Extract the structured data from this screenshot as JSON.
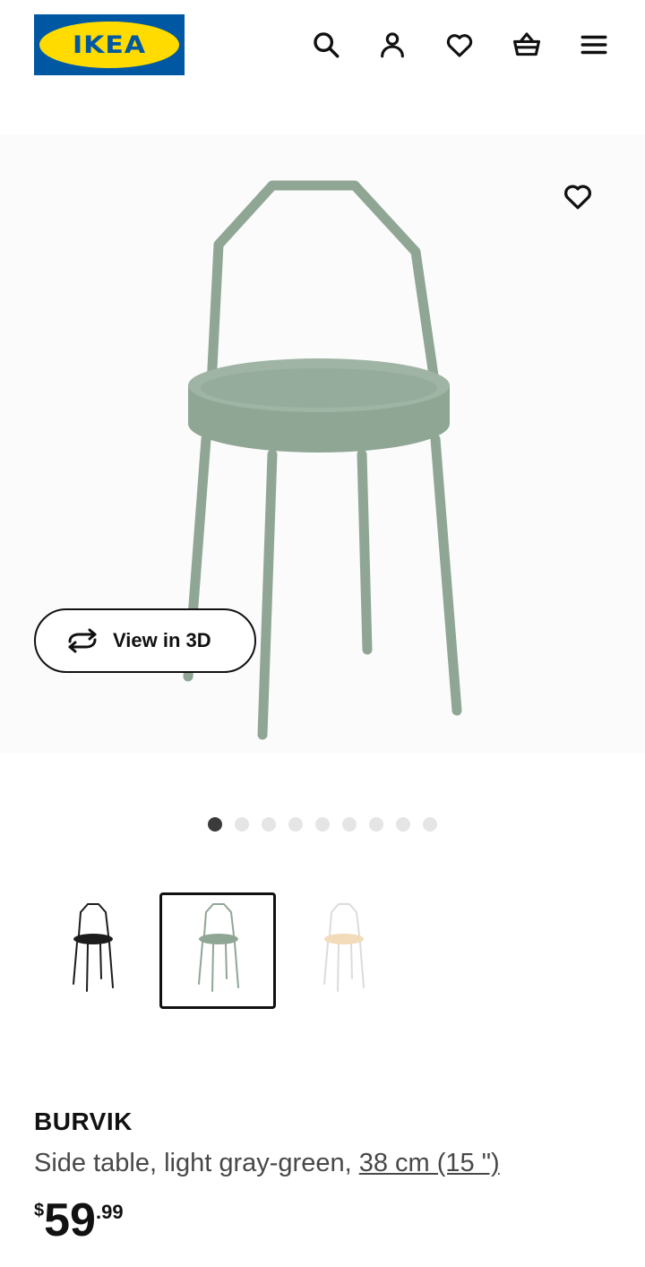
{
  "header": {
    "logo_text": "IKEA",
    "icons": [
      "search-icon",
      "account-icon",
      "wishlist-icon",
      "basket-icon",
      "menu-icon"
    ]
  },
  "gallery": {
    "view_3d_label": "View in 3D",
    "slide_count": 9,
    "active_slide": 1
  },
  "variants": [
    {
      "color_name": "black",
      "color": "#1c1c1c",
      "selected": false
    },
    {
      "color_name": "light gray-green",
      "color": "#8fa695",
      "selected": true
    },
    {
      "color_name": "white/birch",
      "color": "#f2dbb9",
      "selected": false
    }
  ],
  "product": {
    "name": "BURVIK",
    "description": "Side table, light gray-green, ",
    "size": "38 cm (15 \")",
    "price": {
      "currency": "$",
      "integer": "59",
      "decimal": ".99"
    }
  },
  "colors": {
    "ikea_blue": "#0058a3",
    "ikea_yellow": "#ffdb00",
    "product_green": "#8fa695"
  }
}
